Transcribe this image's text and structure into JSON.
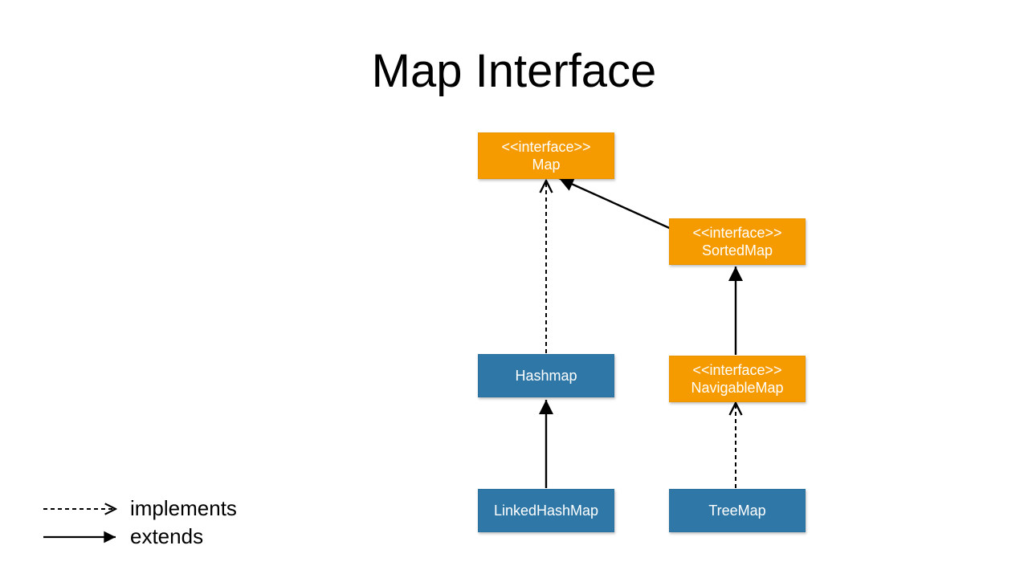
{
  "title": "Map Interface",
  "stereotype": "<<interface>>",
  "nodes": {
    "map": {
      "name": "Map",
      "kind": "interface"
    },
    "sortedmap": {
      "name": "SortedMap",
      "kind": "interface"
    },
    "navigablemap": {
      "name": "NavigableMap",
      "kind": "interface"
    },
    "hashmap": {
      "name": "Hashmap",
      "kind": "class"
    },
    "linkedhashmap": {
      "name": "LinkedHashMap",
      "kind": "class"
    },
    "treemap": {
      "name": "TreeMap",
      "kind": "class"
    }
  },
  "edges": [
    {
      "from": "sortedmap",
      "to": "map",
      "rel": "extends"
    },
    {
      "from": "navigablemap",
      "to": "sortedmap",
      "rel": "extends"
    },
    {
      "from": "linkedhashmap",
      "to": "hashmap",
      "rel": "extends"
    },
    {
      "from": "hashmap",
      "to": "map",
      "rel": "implements"
    },
    {
      "from": "treemap",
      "to": "navigablemap",
      "rel": "implements"
    }
  ],
  "legend": {
    "implements": "implements",
    "extends": "extends"
  }
}
